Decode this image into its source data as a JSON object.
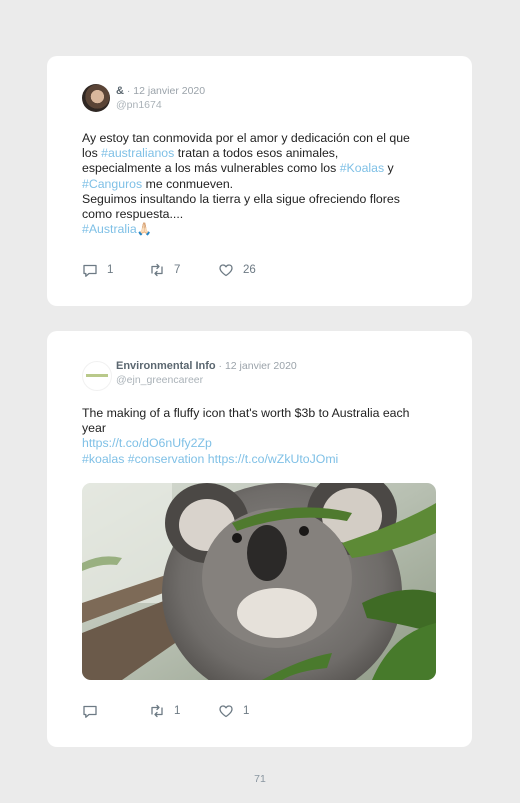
{
  "page_number": "71",
  "tweets": [
    {
      "name": "&",
      "date": "· 12 janvier 2020",
      "handle": "@pn1674",
      "lines": [
        [
          {
            "t": "Ay estoy tan conmovida por el amor y dedicación con el que"
          }
        ],
        [
          {
            "t": "los "
          },
          {
            "t": "#australianos",
            "tag": true
          },
          {
            "t": " tratan a todos esos animales,"
          }
        ],
        [
          {
            "t": "especialmente a los más vulnerables como los "
          },
          {
            "t": "#Koalas",
            "tag": true
          },
          {
            "t": " y"
          }
        ],
        [
          {
            "t": "#Canguros",
            "tag": true
          },
          {
            "t": " me conmueven."
          }
        ],
        [
          {
            "t": "Seguimos insultando la tierra y ella sigue ofreciendo flores"
          }
        ],
        [
          {
            "t": "como respuesta...."
          }
        ],
        [
          {
            "t": "#Australia🙏🏻",
            "tag": true
          }
        ]
      ],
      "replies": "1",
      "retweets": "7",
      "likes": "26"
    },
    {
      "name": "Environmental Info",
      "date": "· 12 janvier 2020",
      "handle": "@ejn_greencareer",
      "lines": [
        [
          {
            "t": "The making of a fluffy icon that's worth $3b to Australia each"
          }
        ],
        [
          {
            "t": "year"
          }
        ],
        [
          {
            "t": "https://t.co/dO6nUfy2Zp",
            "tag": true
          }
        ],
        [
          {
            "t": "#koalas #conservation https://t.co/wZkUtoJOmi",
            "tag": true
          }
        ]
      ],
      "replies": "",
      "retweets": "1",
      "likes": "1"
    }
  ]
}
